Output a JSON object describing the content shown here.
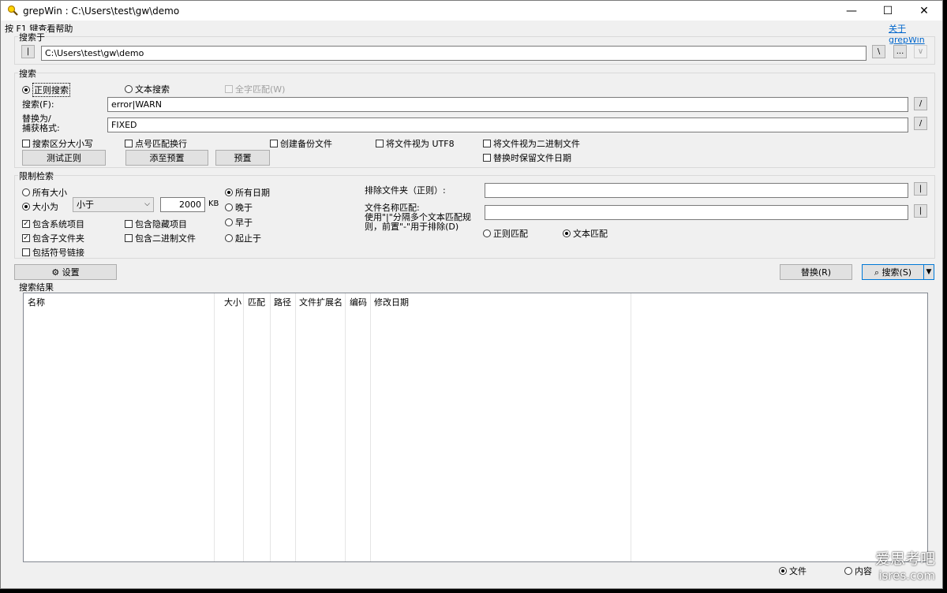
{
  "window": {
    "title": "grepWin : C:\\Users\\test\\gw\\demo",
    "minimize_glyph": "—",
    "maximize_glyph": "☐",
    "close_glyph": "✕",
    "icon": "magnifier-icon"
  },
  "header": {
    "help_hint": "按 F1 键查看帮助",
    "about_link": "关于 grepWin"
  },
  "search_in": {
    "label": "搜索于",
    "toggle_button": "|",
    "path": "C:\\Users\\test\\gw\\demo",
    "backslash_button": "\\",
    "browse_button": "...",
    "dropdown_button": "∨"
  },
  "search": {
    "label": "搜索",
    "mode_regex": "正则搜索",
    "mode_text": "文本搜索",
    "whole_word": "全字匹配(W)",
    "search_label": "搜索(F):",
    "search_value": "error|WARN",
    "replace_label_1": "替换为/",
    "replace_label_2": "捕获格式:",
    "replace_value": "FIXED",
    "slash_button": "/",
    "case_sensitive": "搜索区分大小写",
    "dot_newline": "点号匹配换行",
    "create_backup": "创建备份文件",
    "treat_utf8": "将文件视为 UTF8",
    "treat_binary": "将文件视为二进制文件",
    "keep_date": "替换时保留文件日期",
    "test_regex_button": "测试正则",
    "add_preset_button": "添至预置",
    "preset_button": "预置"
  },
  "limit": {
    "label": "限制检索",
    "all_sizes": "所有大小",
    "size_is": "大小为",
    "size_op": "小于",
    "size_value": "2000",
    "size_unit": "KB",
    "include_system": "包含系统项目",
    "include_hidden": "包含隐藏项目",
    "include_subfolders": "包含子文件夹",
    "include_binary": "包含二进制文件",
    "include_symlinks": "包括符号链接",
    "all_dates": "所有日期",
    "newer": "晚于",
    "older": "早于",
    "between": "起止于",
    "exclude_dirs_label": "排除文件夹（正则）:",
    "exclude_dirs_value": "",
    "file_match_label_1": "文件名称匹配:",
    "file_match_label_2": "使用\"|\"分隔多个文本匹配规",
    "file_match_label_3": "则，前置\"-\"用于排除(D)",
    "file_match_value": "",
    "regex_match": "正则匹配",
    "text_match": "文本匹配",
    "pipe_button": "|"
  },
  "actions": {
    "settings_button": "⚙ 设置",
    "replace_button": "替换(R)",
    "search_button": "⌕ 搜索(S)",
    "search_dropdown": "▼"
  },
  "results": {
    "label": "搜索结果",
    "columns": [
      "名称",
      "大小",
      "匹配",
      "路径",
      "文件扩展名",
      "编码",
      "修改日期"
    ]
  },
  "footer": {
    "files_option": "文件",
    "content_option": "内容"
  },
  "watermark": {
    "line1": "爱思考吧",
    "line2": "isres.com"
  }
}
